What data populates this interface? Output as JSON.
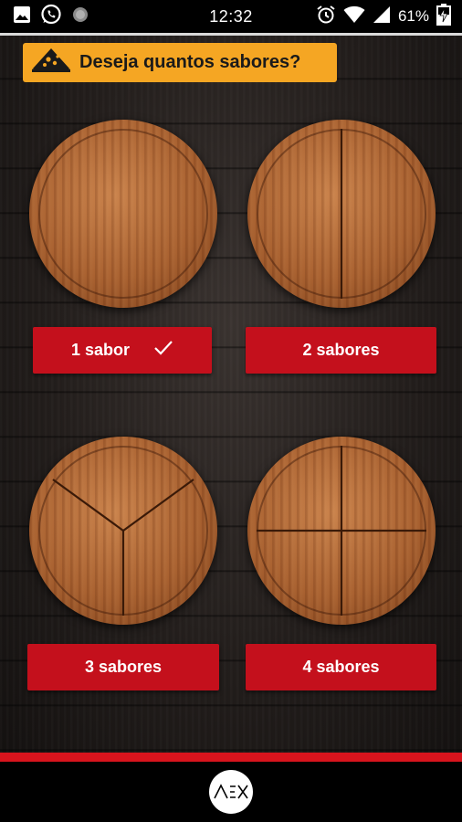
{
  "status_bar": {
    "time": "12:32",
    "battery": "61%",
    "icons_left": [
      "image-icon",
      "whatsapp-icon",
      "circle-notification-icon"
    ],
    "icons_right": [
      "alarm-icon",
      "wifi-icon",
      "signal-icon",
      "battery-charging-icon"
    ]
  },
  "header": {
    "title": "Deseja quantos sabores?",
    "icon": "pizza-slice-icon",
    "color": "#f5a623"
  },
  "options": [
    {
      "label": "1 sabor",
      "slices": 1,
      "selected": true
    },
    {
      "label": "2 sabores",
      "slices": 2,
      "selected": false
    },
    {
      "label": "3 sabores",
      "slices": 3,
      "selected": false
    },
    {
      "label": "4 sabores",
      "slices": 4,
      "selected": false
    }
  ],
  "colors": {
    "button": "#c4101c",
    "accent_bar": "#d8141d"
  },
  "footer": {
    "logo_text": "AEX"
  }
}
